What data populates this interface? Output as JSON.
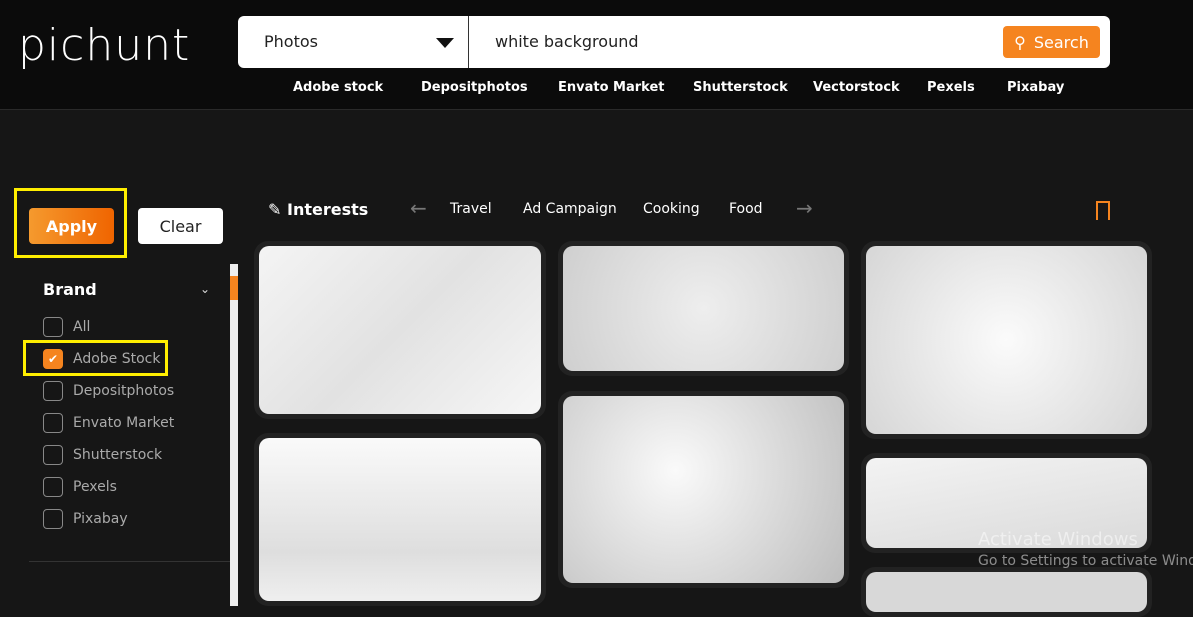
{
  "header": {
    "logo": "pichunt",
    "category": "Photos",
    "query": "white background",
    "search_label": "Search",
    "links": [
      "Adobe stock",
      "Depositphotos",
      "Envato Market",
      "Shutterstock",
      "Vectorstock",
      "Pexels",
      "Pixabay"
    ]
  },
  "filters": {
    "apply_label": "Apply",
    "clear_label": "Clear",
    "section": "Brand",
    "brands": [
      {
        "label": "All",
        "checked": false
      },
      {
        "label": "Adobe Stock",
        "checked": true
      },
      {
        "label": "Depositphotos",
        "checked": false
      },
      {
        "label": "Envato Market",
        "checked": false
      },
      {
        "label": "Shutterstock",
        "checked": false
      },
      {
        "label": "Pexels",
        "checked": false
      },
      {
        "label": "Pixabay",
        "checked": false
      }
    ]
  },
  "interests": {
    "label": "Interests",
    "tags": [
      "Travel",
      "Ad Campaign",
      "Cooking",
      "Food"
    ]
  },
  "colors": {
    "accent": "#f5841f",
    "highlight": "#ffee00"
  },
  "watermark": {
    "title": "Activate Windows",
    "subtitle": "Go to Settings to activate Windows."
  }
}
